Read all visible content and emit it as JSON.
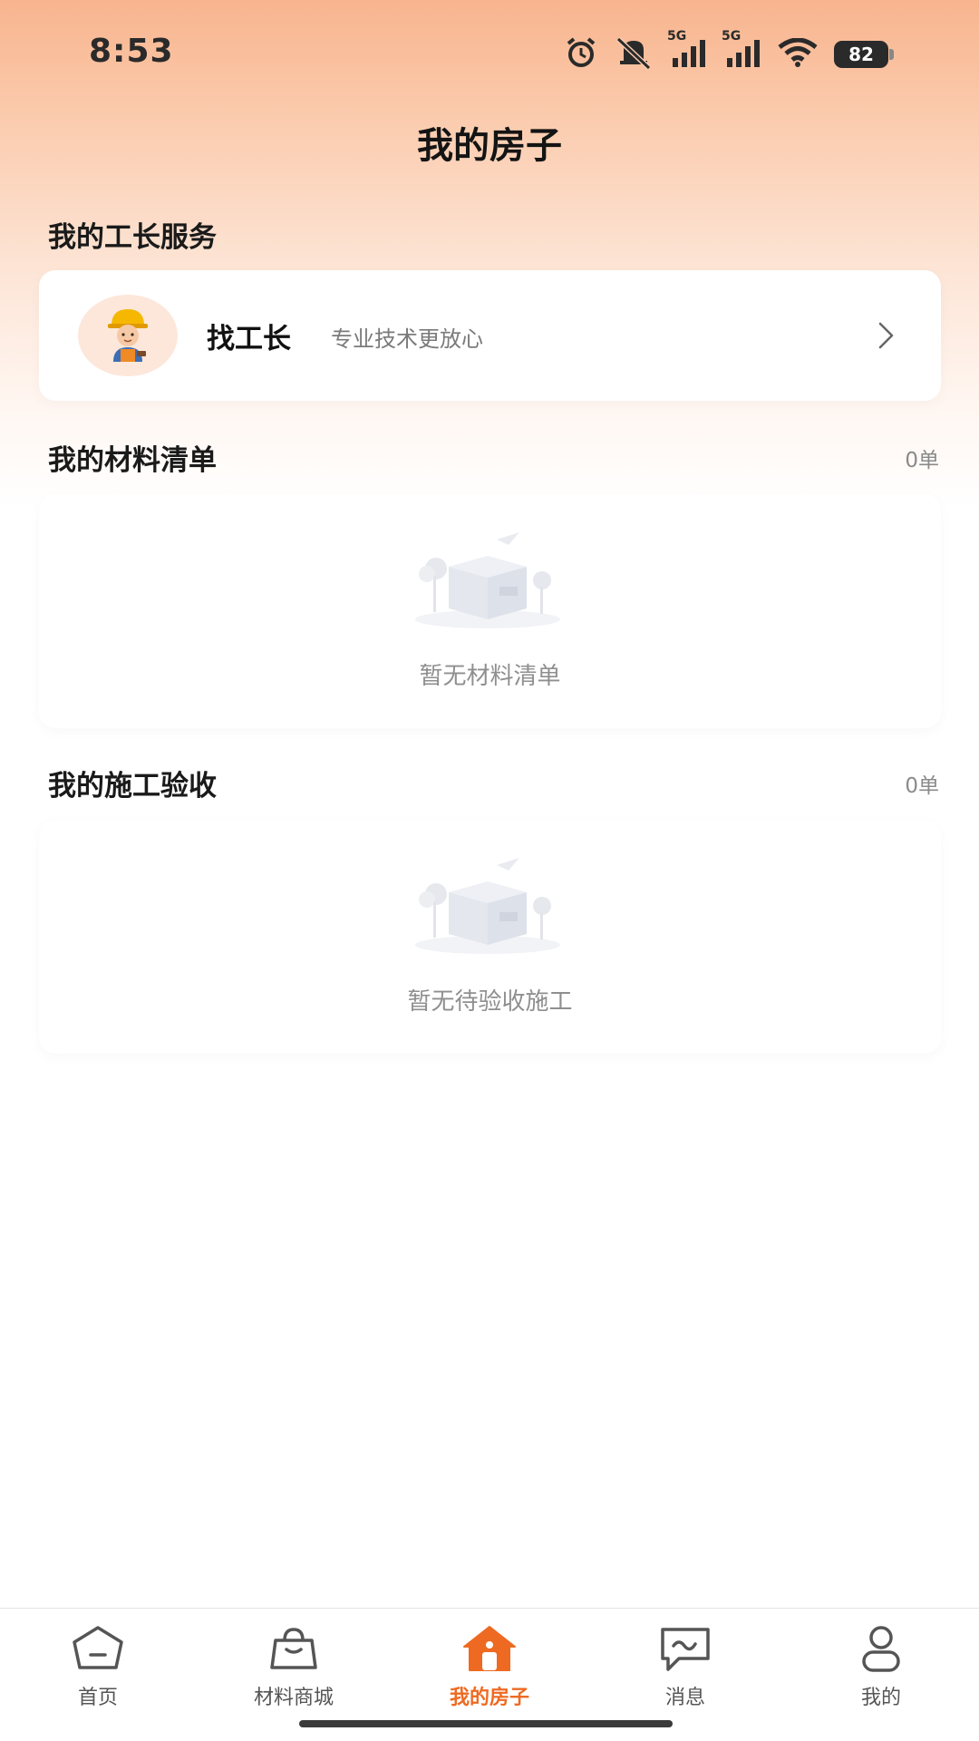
{
  "status_bar": {
    "time": "8:53",
    "network_1": "5G",
    "network_2": "5G",
    "battery": "82",
    "icons": [
      "alarm-icon",
      "mute-icon",
      "signal-5g-icon",
      "signal-5g-icon",
      "wifi-icon",
      "battery-icon"
    ]
  },
  "page": {
    "title": "我的房子"
  },
  "foreman_section": {
    "title": "我的工长服务",
    "card": {
      "name": "找工长",
      "description": "专业技术更放心",
      "avatar": "worker-avatar-icon",
      "action_icon": "chevron-right-icon"
    }
  },
  "materials_section": {
    "title": "我的材料清单",
    "count": "0单",
    "empty_text": "暂无材料清单"
  },
  "inspection_section": {
    "title": "我的施工验收",
    "count": "0单",
    "empty_text": "暂无待验收施工"
  },
  "tabbar": {
    "active": "我的房子",
    "active_color": "#ee6a22",
    "tabs": [
      {
        "label": "首页",
        "icon": "home-icon"
      },
      {
        "label": "材料商城",
        "icon": "shopping-bag-icon"
      },
      {
        "label": "我的房子",
        "icon": "house-icon"
      },
      {
        "label": "消息",
        "icon": "message-icon"
      },
      {
        "label": "我的",
        "icon": "user-icon"
      }
    ]
  },
  "colors": {
    "accent": "#ee6a22",
    "header_gradient_top": "#f8b48e"
  }
}
